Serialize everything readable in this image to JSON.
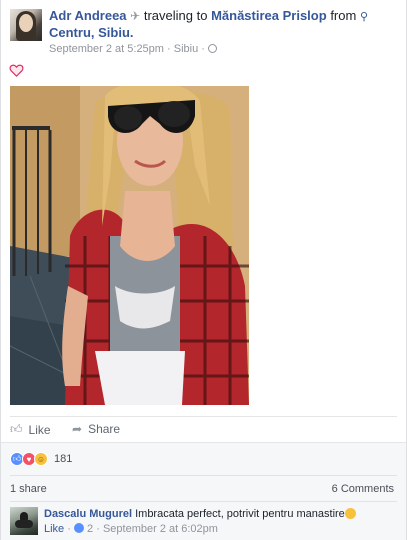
{
  "post": {
    "author": "Adr Andreea",
    "activity_icon": "airplane-icon",
    "activity_text": "traveling to",
    "destination": "Mănăstirea Prislop",
    "from_text": "from",
    "origin_icon": "location-pin-icon",
    "origin": "Centru, Sibiu.",
    "timestamp": "September 2 at 5:25pm",
    "separator": "·",
    "location": "Sibiu",
    "privacy_icon": "globe-icon",
    "reaction_button_icon": "heart-outline-icon"
  },
  "actions": {
    "like_label": "Like",
    "share_label": "Share"
  },
  "reactions": {
    "types": [
      "like",
      "love",
      "haha"
    ],
    "count": "181",
    "colors": {
      "like": "#5890ff",
      "love": "#f25268",
      "haha": "#f7c13b"
    }
  },
  "stats": {
    "shares": "1 share",
    "comments": "6 Comments"
  },
  "comment": {
    "author": "Dascalu Mugurel",
    "text": "Imbracata perfect, potrivit pentru manastire",
    "emoji": "smiley-icon",
    "like_label": "Like",
    "dot": "·",
    "likes_count": "2",
    "timestamp": "September 2 at 6:02pm"
  },
  "theme": {
    "link_color": "#365899",
    "meta_color": "#90949c"
  }
}
